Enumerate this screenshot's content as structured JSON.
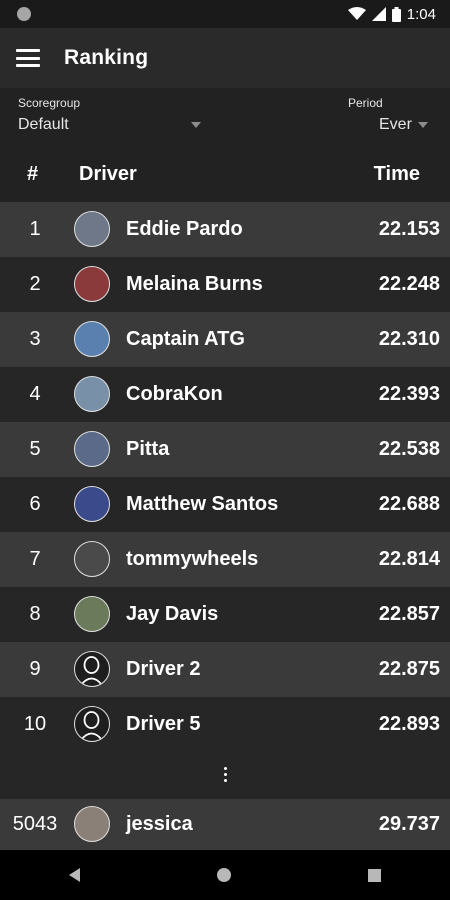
{
  "status": {
    "time": "1:04"
  },
  "appbar": {
    "title": "Ranking"
  },
  "filters": {
    "scoregroup_label": "Scoregroup",
    "scoregroup_value": "Default",
    "period_label": "Period",
    "period_value": "Ever"
  },
  "table": {
    "col_rank": "#",
    "col_driver": "Driver",
    "col_time": "Time",
    "rows": [
      {
        "rank": "1",
        "name": "Eddie Pardo",
        "time": "22.153",
        "avatar_color": "#6e7888"
      },
      {
        "rank": "2",
        "name": "Melaina Burns",
        "time": "22.248",
        "avatar_color": "#8a3a3a"
      },
      {
        "rank": "3",
        "name": "Captain ATG",
        "time": "22.310",
        "avatar_color": "#5a80b0"
      },
      {
        "rank": "4",
        "name": "CobraKon",
        "time": "22.393",
        "avatar_color": "#7890a8"
      },
      {
        "rank": "5",
        "name": "Pitta",
        "time": "22.538",
        "avatar_color": "#5a6a88"
      },
      {
        "rank": "6",
        "name": "Matthew Santos",
        "time": "22.688",
        "avatar_color": "#3a4a8a"
      },
      {
        "rank": "7",
        "name": "tommywheels",
        "time": "22.814",
        "avatar_color": "#4a4a4a"
      },
      {
        "rank": "8",
        "name": "Jay Davis",
        "time": "22.857",
        "avatar_color": "#6a7a5a"
      },
      {
        "rank": "9",
        "name": "Driver 2",
        "time": "22.875",
        "avatar_color": "#1e1e1e"
      },
      {
        "rank": "10",
        "name": "Driver 5",
        "time": "22.893",
        "avatar_color": "#1e1e1e"
      }
    ],
    "current_user": {
      "rank": "5043",
      "name": "jessica",
      "time": "29.737",
      "avatar_color": "#8a8078"
    }
  }
}
